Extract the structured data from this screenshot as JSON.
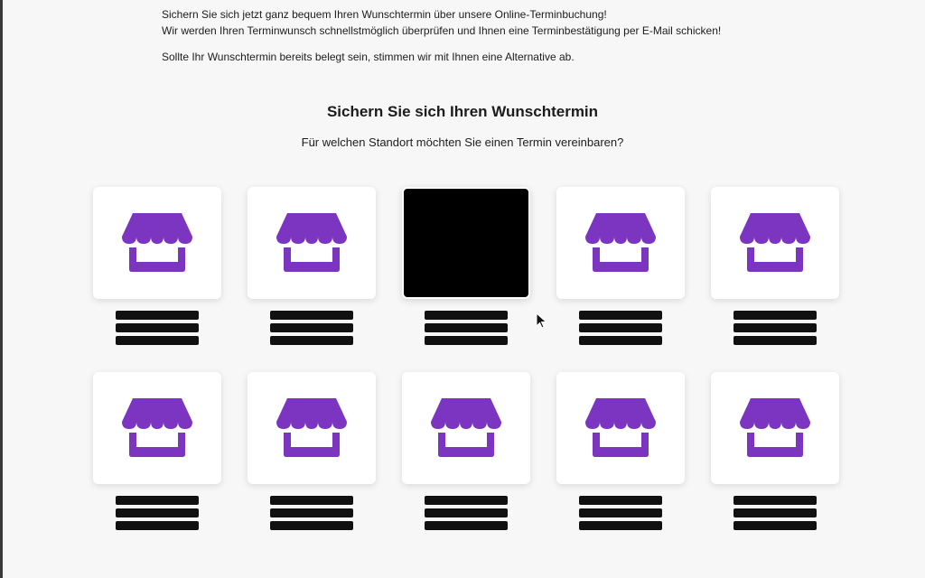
{
  "intro": {
    "line1": "Sichern Sie sich jetzt ganz bequem Ihren Wunschtermin über unsere Online-Terminbuchung!",
    "line2": "Wir werden Ihren Terminwunsch schnellstmöglich überprüfen und Ihnen eine Terminbestätigung per E-Mail schicken!",
    "line3": "Sollte Ihr Wunschtermin bereits belegt sein, stimmen wir mit Ihnen eine Alternative ab."
  },
  "heading": "Sichern Sie sich Ihren Wunschtermin",
  "subheading": "Für welchen Standort möchten Sie einen Termin vereinbaren?",
  "colors": {
    "accent": "#7b35c0",
    "redacted": "#000000"
  },
  "locations": [
    {
      "icon": "store-icon",
      "redacted": false
    },
    {
      "icon": "store-icon",
      "redacted": false
    },
    {
      "icon": "store-icon",
      "redacted": true
    },
    {
      "icon": "store-icon",
      "redacted": false
    },
    {
      "icon": "store-icon",
      "redacted": false
    },
    {
      "icon": "store-icon",
      "redacted": false
    },
    {
      "icon": "store-icon",
      "redacted": false
    },
    {
      "icon": "store-icon",
      "redacted": false
    },
    {
      "icon": "store-icon",
      "redacted": false
    },
    {
      "icon": "store-icon",
      "redacted": false
    }
  ]
}
